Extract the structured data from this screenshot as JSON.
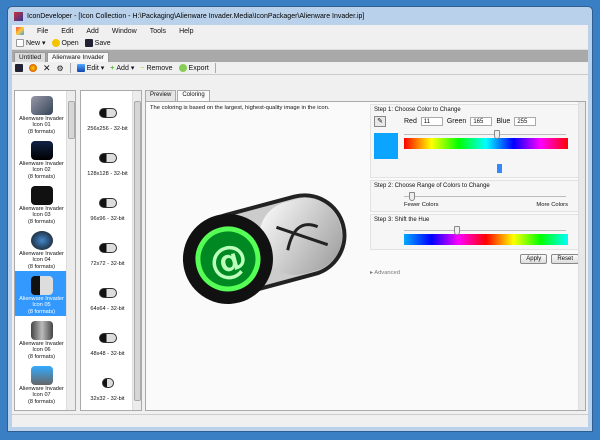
{
  "window": {
    "title": "IconDeveloper - [Icon Collection - H:\\Packaging\\Alienware Invader.Media\\IconPackager\\Alienware Invader.ip]"
  },
  "menu": [
    "File",
    "Edit",
    "Add",
    "Window",
    "Tools",
    "Help"
  ],
  "toolbar": {
    "new": "New",
    "open": "Open",
    "save": "Save"
  },
  "doc_tabs": [
    "Untitled",
    "Alienware Invader"
  ],
  "toolbar2": {
    "edit": "Edit",
    "add": "Add",
    "remove": "Remove",
    "export": "Export"
  },
  "icons": [
    {
      "name": "Alienware Invader Icon 01",
      "formats": "(8 formats)"
    },
    {
      "name": "Alienware Invader Icon 02",
      "formats": "(8 formats)"
    },
    {
      "name": "Alienware Invader Icon 03",
      "formats": "(8 formats)"
    },
    {
      "name": "Alienware Invader Icon 04",
      "formats": "(8 formats)"
    },
    {
      "name": "Alienware Invader Icon 05",
      "formats": "(8 formats)"
    },
    {
      "name": "Alienware Invader Icon 06",
      "formats": "(8 formats)"
    },
    {
      "name": "Alienware Invader Icon 07",
      "formats": "(8 formats)"
    }
  ],
  "formats": [
    "256x256 - 32-bit",
    "128x128 - 32-bit",
    "96x96 - 32-bit",
    "72x72 - 32-bit",
    "64x64 - 32-bit",
    "48x48 - 32-bit",
    "32x32 - 32-bit"
  ],
  "view_tabs": [
    "Preview",
    "Coloring"
  ],
  "coloring": {
    "note": "The coloring is based on the largest, highest-quality image in the icon.",
    "step1": "Step 1: Choose Color to Change",
    "red_label": "Red",
    "red": "11",
    "green_label": "Green",
    "green": "165",
    "blue_label": "Blue",
    "blue": "255",
    "selected_color": "#0ba5ff",
    "hue_position": 0.58,
    "step2": "Step 2: Choose Range of Colors to Change",
    "range_position": 0.03,
    "fewer": "Fewer Colors",
    "more": "More Colors",
    "step3": "Step 3: Shift the Hue",
    "shift_position": 0.32,
    "apply": "Apply",
    "reset": "Reset",
    "advanced": "Advanced"
  }
}
